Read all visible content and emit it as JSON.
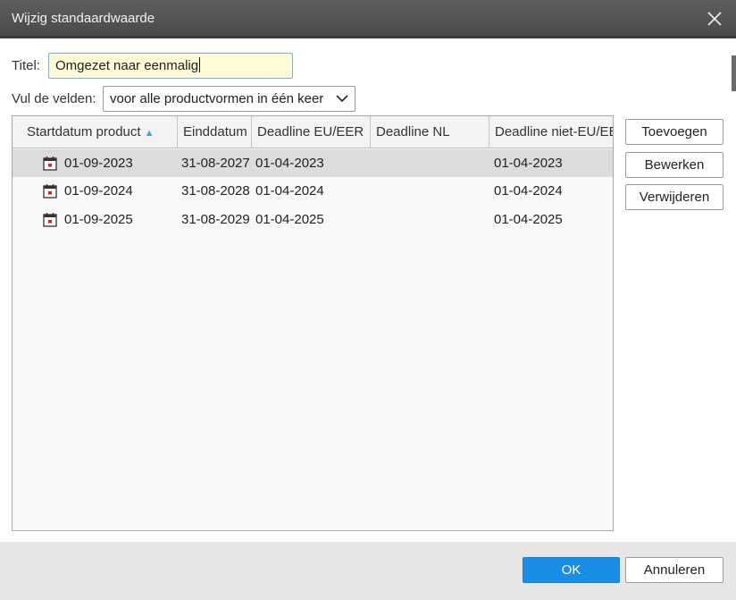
{
  "window": {
    "title": "Wijzig standaardwaarde"
  },
  "form": {
    "title_label": "Titel:",
    "title_value": "Omgezet naar eenmalig",
    "fill_label": "Vul de velden:",
    "fill_value": "voor alle productvormen in één keer"
  },
  "table": {
    "columns": [
      {
        "label": "Startdatum product",
        "sorted": "ascending"
      },
      {
        "label": "Einddatum"
      },
      {
        "label": "Deadline EU/EER"
      },
      {
        "label": "Deadline NL"
      },
      {
        "label": "Deadline niet-EU/EER"
      }
    ],
    "rows": [
      {
        "start": "01-09-2023",
        "end": "31-08-2027",
        "eu": "01-04-2023",
        "nl": "",
        "non_eu": "01-04-2023",
        "selected": true
      },
      {
        "start": "01-09-2024",
        "end": "31-08-2028",
        "eu": "01-04-2024",
        "nl": "",
        "non_eu": "01-04-2024",
        "selected": false
      },
      {
        "start": "01-09-2025",
        "end": "31-08-2029",
        "eu": "01-04-2025",
        "nl": "",
        "non_eu": "01-04-2025",
        "selected": false
      }
    ],
    "row_icon": "calendar-icon"
  },
  "side_buttons": {
    "add": "Toevoegen",
    "edit": "Bewerken",
    "delete": "Verwijderen"
  },
  "footer": {
    "ok": "OK",
    "cancel": "Annuleren"
  },
  "colors": {
    "primary_button": "#1a8ee6",
    "input_focus_bg": "#fdfbd5",
    "sort_arrow": "#41a6e0",
    "selected_row": "#dcdcdc"
  }
}
